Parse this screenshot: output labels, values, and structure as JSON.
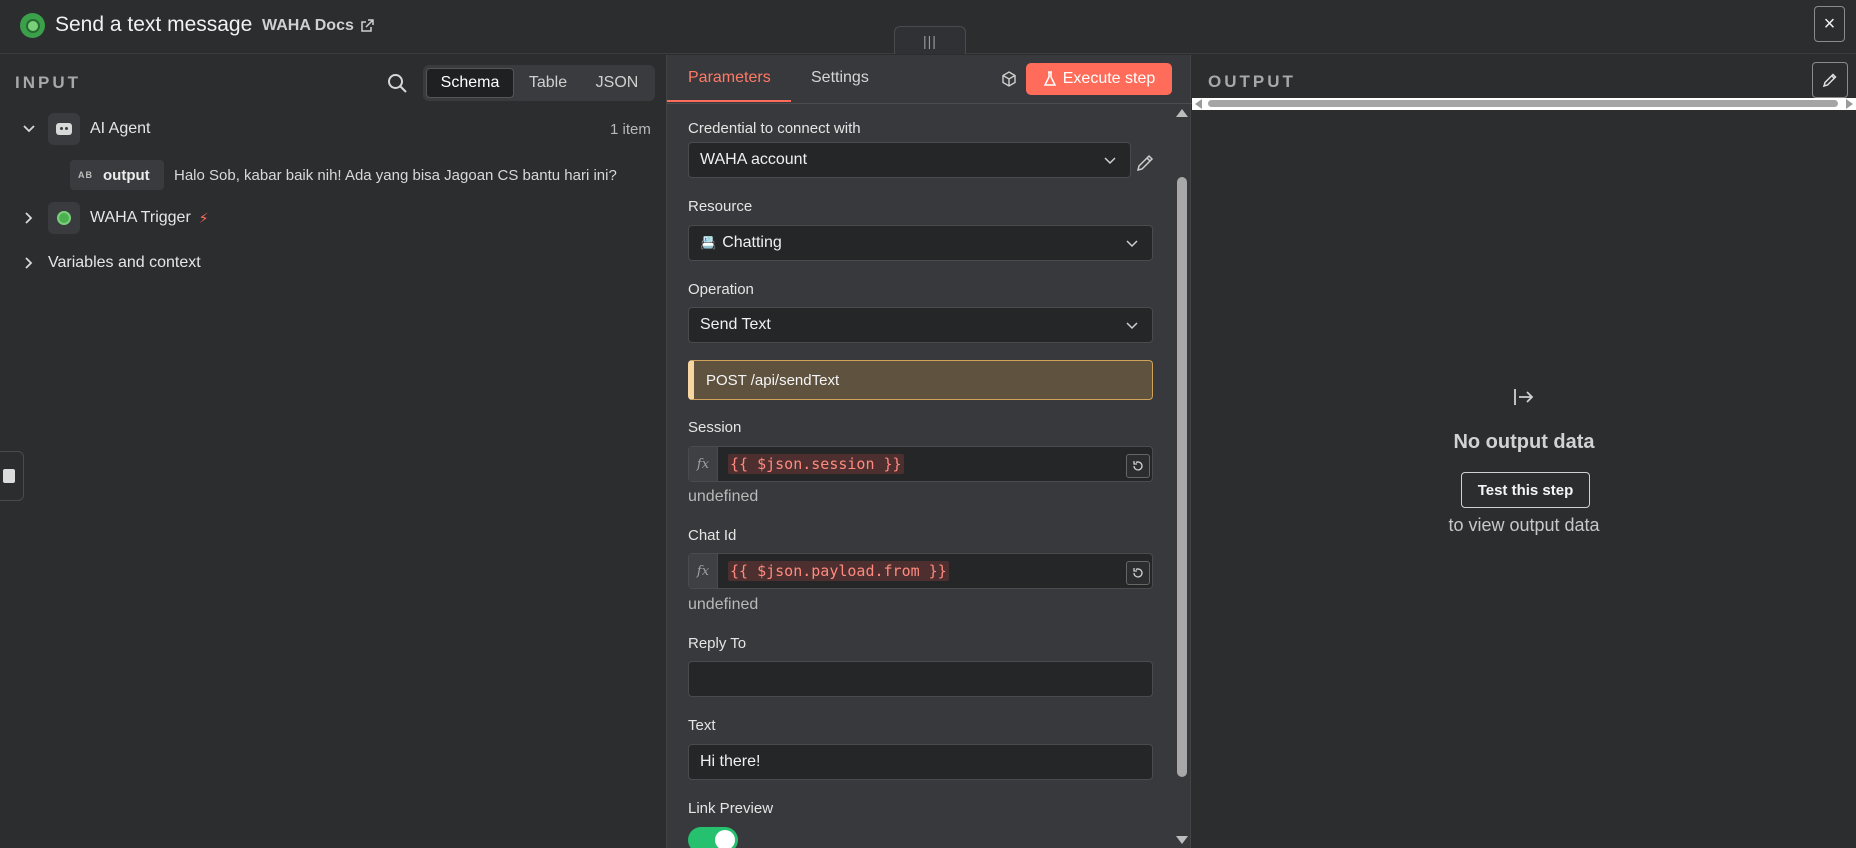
{
  "header": {
    "title": "Send a text message",
    "docs_link": "WAHA Docs",
    "close_label": "×"
  },
  "input": {
    "label": "INPUT",
    "view_tabs": [
      {
        "label": "Schema",
        "active": true
      },
      {
        "label": "Table",
        "active": false
      },
      {
        "label": "JSON",
        "active": false
      }
    ],
    "tree": {
      "ai_agent": {
        "label": "AI Agent",
        "count": "1 item"
      },
      "output_field": {
        "type_badge": "AB",
        "key": "output",
        "value": "Halo Sob, kabar baik nih! Ada yang bisa Jagoan CS bantu hari ini?"
      },
      "waha_trigger": {
        "label": "WAHA Trigger"
      },
      "variables": {
        "label": "Variables and context"
      }
    }
  },
  "params": {
    "tabs": [
      {
        "label": "Parameters",
        "active": true
      },
      {
        "label": "Settings",
        "active": false
      }
    ],
    "execute_label": "Execute step",
    "credential": {
      "label": "Credential to connect with",
      "value": "WAHA account"
    },
    "resource": {
      "label": "Resource",
      "value": "Chatting",
      "icon": "📇"
    },
    "operation": {
      "label": "Operation",
      "value": "Send Text"
    },
    "notice": "POST /api/sendText",
    "session": {
      "label": "Session",
      "expression": "{{ $json.session }}",
      "hint": "undefined"
    },
    "chat_id": {
      "label": "Chat Id",
      "expression": "{{ $json.payload.from }}",
      "hint": "undefined"
    },
    "reply_to": {
      "label": "Reply To",
      "value": ""
    },
    "text": {
      "label": "Text",
      "value": "Hi there!"
    },
    "link_preview": {
      "label": "Link Preview",
      "enabled": true
    },
    "fx_label": "fx"
  },
  "output": {
    "label": "OUTPUT",
    "empty_title": "No output data",
    "test_button": "Test this step",
    "empty_sub": "to view output data"
  },
  "colors": {
    "accent": "#ff6d5a",
    "toggle_on": "#25c16f",
    "notice_bg": "#5f523f"
  }
}
